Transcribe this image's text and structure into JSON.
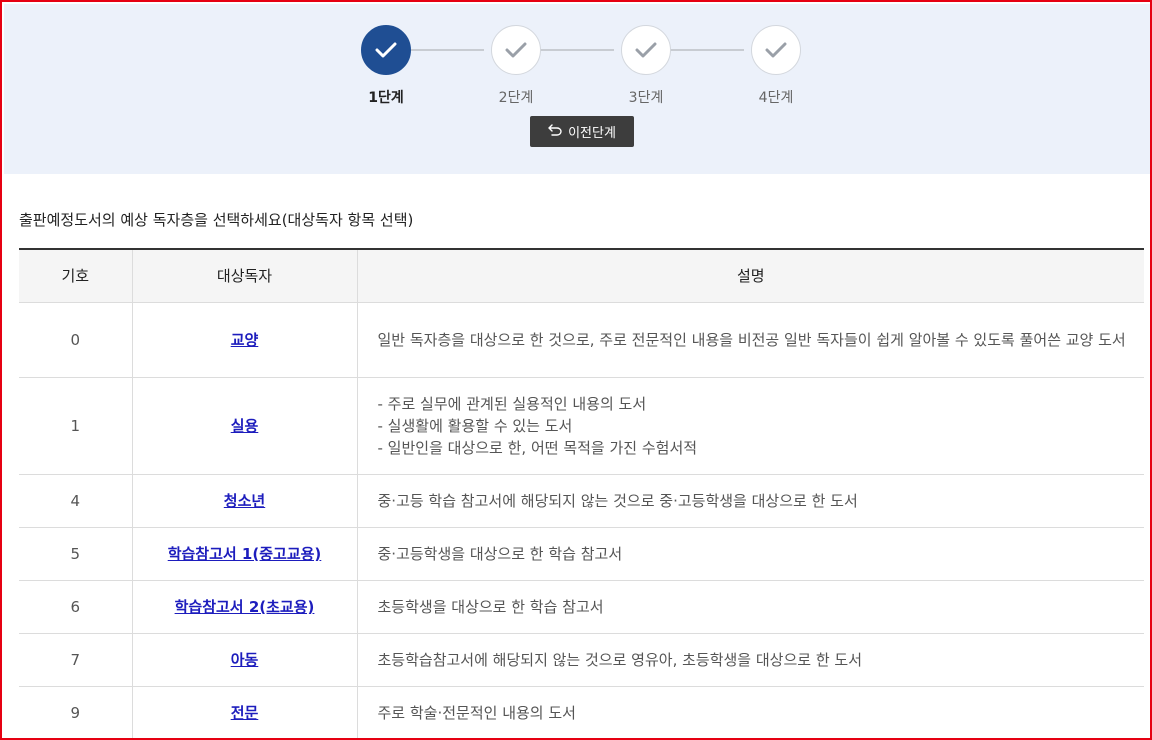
{
  "stepper": {
    "steps": [
      {
        "label": "1단계",
        "active": true
      },
      {
        "label": "2단계",
        "active": false
      },
      {
        "label": "3단계",
        "active": false
      },
      {
        "label": "4단계",
        "active": false
      }
    ],
    "prev_button": "이전단계"
  },
  "instruction": "출판예정도서의 예상 독자층을 선택하세요(대상독자 항목 선택)",
  "table": {
    "headers": [
      "기호",
      "대상독자",
      "설명"
    ],
    "rows": [
      {
        "code": "0",
        "name": "교양",
        "desc": [
          "일반 독자층을 대상으로 한 것으로, 주로 전문적인 내용을 비전공 일반 독자들이 쉽게 알아볼 수 있도록 풀어쓴 교양 도서"
        ]
      },
      {
        "code": "1",
        "name": "실용",
        "desc": [
          "- 주로 실무에 관계된 실용적인 내용의 도서",
          "- 실생활에 활용할 수 있는 도서",
          "- 일반인을 대상으로 한, 어떤 목적을 가진 수험서적"
        ]
      },
      {
        "code": "4",
        "name": "청소년",
        "desc": [
          "중·고등 학습 참고서에 해당되지 않는 것으로 중·고등학생을 대상으로 한 도서"
        ]
      },
      {
        "code": "5",
        "name": "학습참고서 1(중고교용)",
        "desc": [
          "중·고등학생을 대상으로 한 학습 참고서"
        ]
      },
      {
        "code": "6",
        "name": "학습참고서 2(초교용)",
        "desc": [
          "초등학생을 대상으로 한 학습 참고서"
        ]
      },
      {
        "code": "7",
        "name": "아동",
        "desc": [
          "초등학습참고서에 해당되지 않는 것으로 영유아, 초등학생을 대상으로 한 도서"
        ]
      },
      {
        "code": "9",
        "name": "전문",
        "desc": [
          "주로 학술·전문적인 내용의 도서"
        ]
      }
    ]
  },
  "colors": {
    "active_step": "#1f4e93",
    "link": "#1d1dbd",
    "frame_border": "#e60012",
    "button_bg": "#3d3d3d"
  }
}
